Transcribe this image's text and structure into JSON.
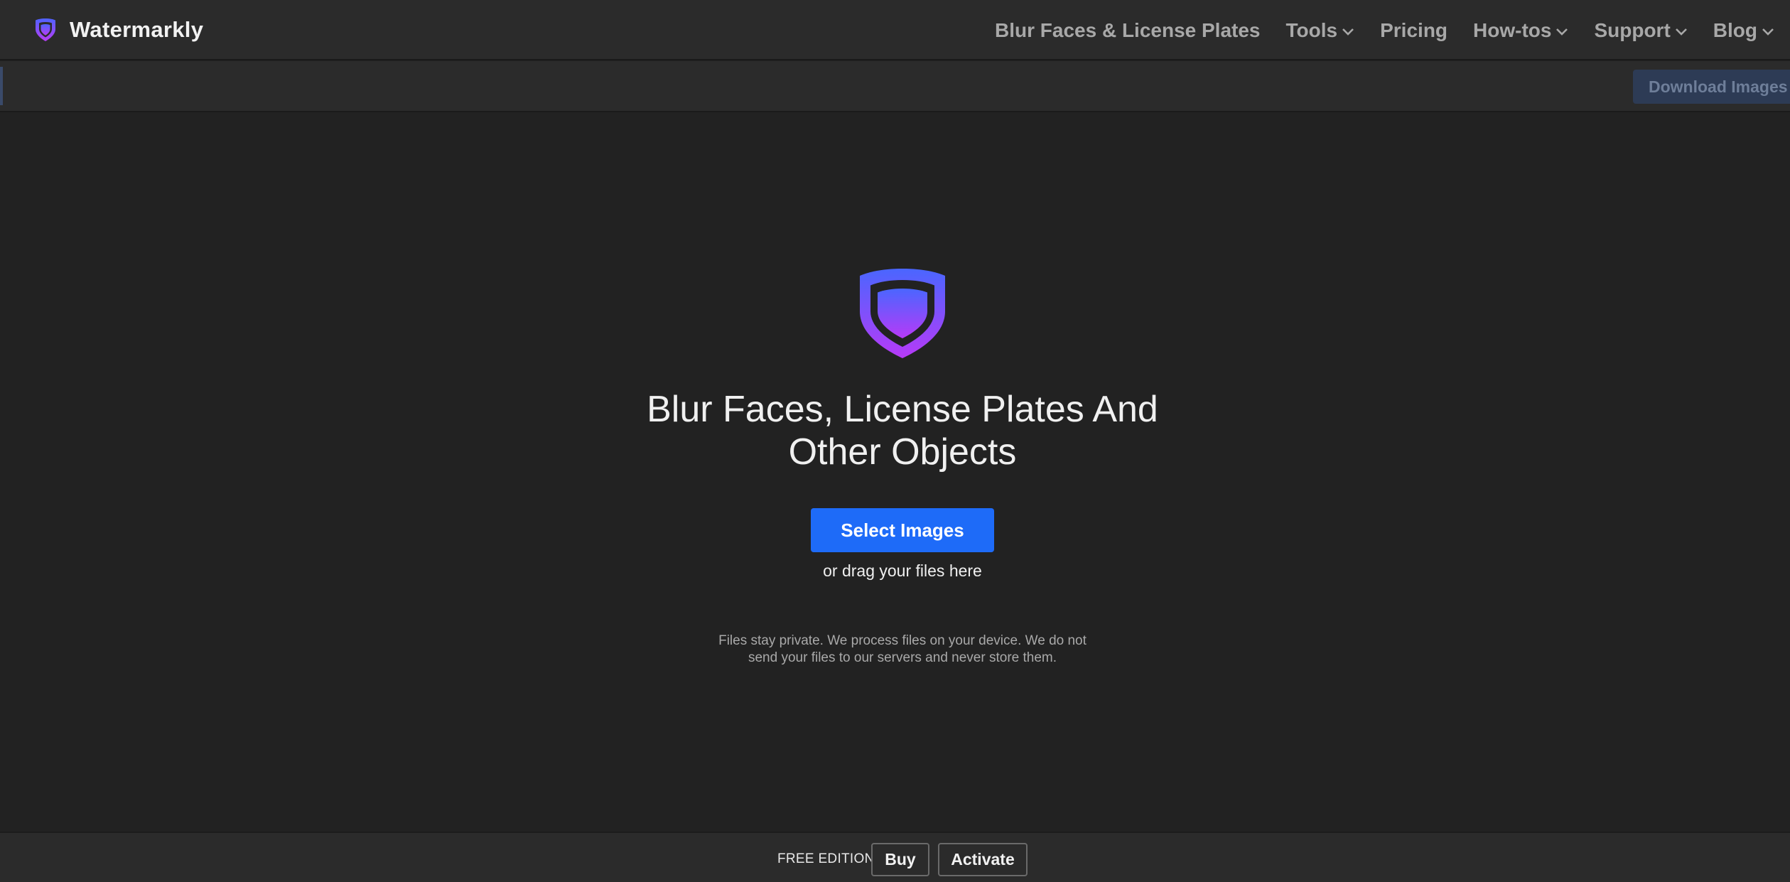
{
  "brand": {
    "name": "Watermarkly",
    "logo_gradient": [
      "#4f63ff",
      "#b83cf5"
    ]
  },
  "nav": {
    "items": [
      {
        "label": "Blur Faces & License Plates",
        "has_dropdown": false
      },
      {
        "label": "Tools",
        "has_dropdown": true
      },
      {
        "label": "Pricing",
        "has_dropdown": false
      },
      {
        "label": "How-tos",
        "has_dropdown": true
      },
      {
        "label": "Support",
        "has_dropdown": true
      },
      {
        "label": "Blog",
        "has_dropdown": true
      }
    ]
  },
  "toolbar": {
    "download_label": "Download Images"
  },
  "hero": {
    "title_line1": "Blur Faces, License Plates And",
    "title_line2": "Other Objects",
    "select_label": "Select Images",
    "drag_text": "or drag your files here",
    "privacy_line1": "Files stay private. We process files on your device. We do not",
    "privacy_line2": "send your files to our servers and never store them."
  },
  "footer": {
    "edition": "FREE EDITION",
    "buy_label": "Buy",
    "activate_label": "Activate"
  },
  "colors": {
    "background": "#222222",
    "bar": "#2b2b2b",
    "accent": "#1e6bf8"
  }
}
